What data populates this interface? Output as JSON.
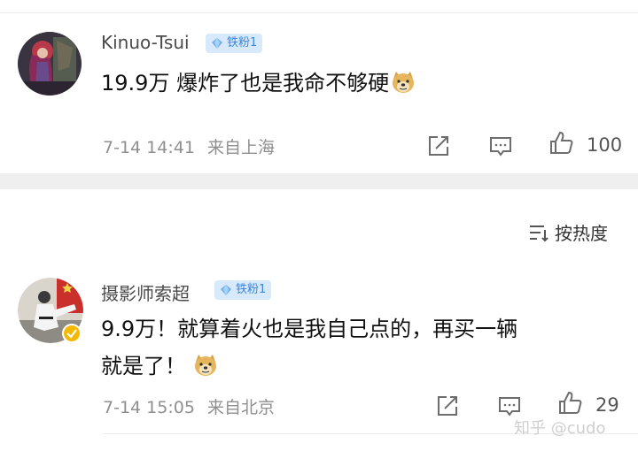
{
  "comments": [
    {
      "username": "Kinuo-Tsui",
      "badge": "铁粉1",
      "text": "19.9万 爆炸了也是我命不够硬",
      "emoji": "doge-icon",
      "time": "7-14 14:41",
      "location": "来自上海",
      "likes": "100"
    },
    {
      "username": "摄影师索超",
      "badge": "铁粉1",
      "text_line1": "9.9万！就算着火也是我自己点的，再买一辆",
      "text_line2": "就是了！",
      "emoji": "doge-icon",
      "time": "7-14 15:05",
      "location": "来自北京",
      "likes": "29"
    }
  ],
  "sort": {
    "label": "按热度",
    "icon": "sort-icon"
  },
  "watermark": "知乎 @cudo",
  "colors": {
    "badge_bg": "#d7e9fb",
    "badge_text": "#3b86d6",
    "meta": "#8f8f8f",
    "divider": "#efefef"
  }
}
